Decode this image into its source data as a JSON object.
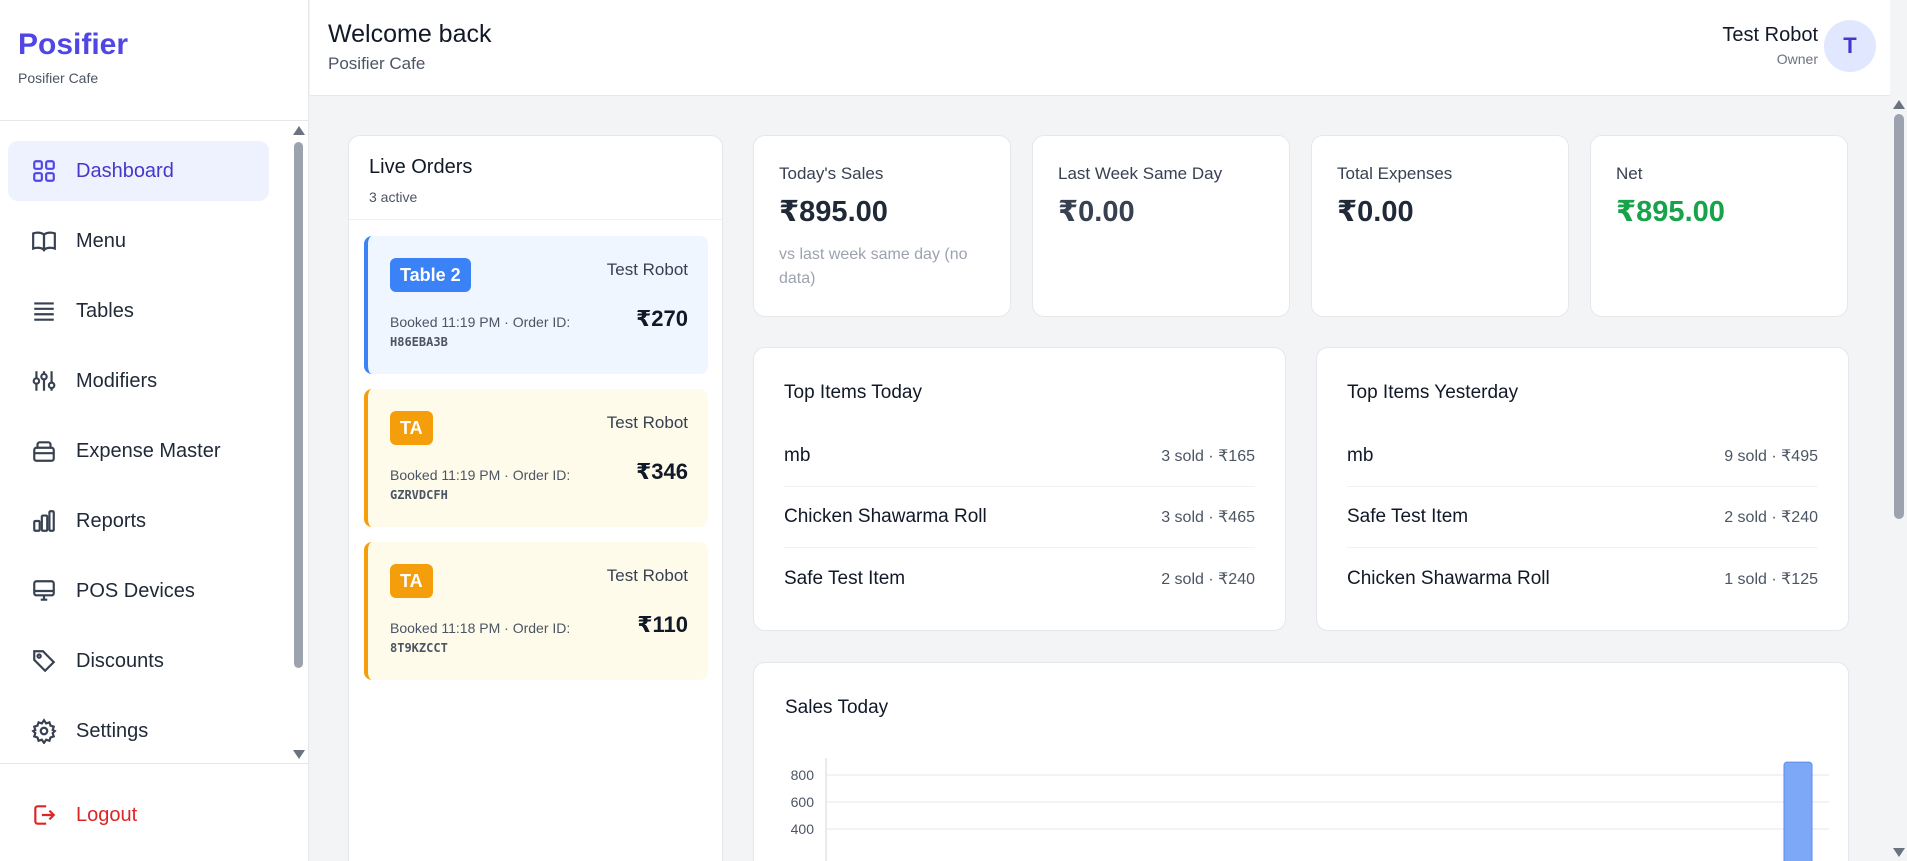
{
  "sidebar": {
    "brand": "Posifier",
    "subtitle": "Posifier Cafe",
    "items": [
      {
        "label": "Dashboard",
        "icon": "grid-icon",
        "active": true
      },
      {
        "label": "Menu",
        "icon": "book-icon"
      },
      {
        "label": "Tables",
        "icon": "list-icon"
      },
      {
        "label": "Modifiers",
        "icon": "sliders-icon"
      },
      {
        "label": "Expense Master",
        "icon": "wallet-icon"
      },
      {
        "label": "Reports",
        "icon": "bar-chart-icon"
      },
      {
        "label": "POS Devices",
        "icon": "monitor-icon"
      },
      {
        "label": "Discounts",
        "icon": "tag-icon"
      },
      {
        "label": "Settings",
        "icon": "gear-icon"
      }
    ],
    "logout": "Logout"
  },
  "header": {
    "title": "Welcome back",
    "subtitle": "Posifier Cafe",
    "user_name": "Test Robot",
    "user_role": "Owner",
    "avatar_initial": "T"
  },
  "live_orders": {
    "title": "Live Orders",
    "count": "3 active",
    "orders": [
      {
        "tag": "Table 2",
        "waiter": "Test Robot",
        "booked": "Booked 11:19 PM · Order ID:",
        "order_id": "H86EBA3B",
        "amount": "₹270",
        "kind": "table"
      },
      {
        "tag": "TA",
        "waiter": "Test Robot",
        "booked": "Booked 11:19 PM · Order ID:",
        "order_id": "GZRVDCFH",
        "amount": "₹346",
        "kind": "takeaway"
      },
      {
        "tag": "TA",
        "waiter": "Test Robot",
        "booked": "Booked 11:18 PM · Order ID:",
        "order_id": "8T9KZCCT",
        "amount": "₹110",
        "kind": "takeaway"
      }
    ]
  },
  "stats": [
    {
      "label": "Today's Sales",
      "value": "₹895.00",
      "note": "vs last week same day (no data)"
    },
    {
      "label": "Last Week Same Day",
      "value": "₹0.00"
    },
    {
      "label": "Total Expenses",
      "value": "₹0.00"
    },
    {
      "label": "Net",
      "value": "₹895.00"
    }
  ],
  "top_today": {
    "title": "Top Items Today",
    "items": [
      {
        "name": "mb",
        "meta": "3 sold · ₹165"
      },
      {
        "name": "Chicken Shawarma Roll",
        "meta": "3 sold · ₹465"
      },
      {
        "name": "Safe Test Item",
        "meta": "2 sold · ₹240"
      }
    ]
  },
  "top_yesterday": {
    "title": "Top Items Yesterday",
    "items": [
      {
        "name": "mb",
        "meta": "9 sold · ₹495"
      },
      {
        "name": "Safe Test Item",
        "meta": "2 sold · ₹240"
      },
      {
        "name": "Chicken Shawarma Roll",
        "meta": "1 sold · ₹125"
      }
    ]
  },
  "sales_today": {
    "title": "Sales Today"
  },
  "chart_data": {
    "type": "bar",
    "title": "Sales Today",
    "y_ticks": [
      800,
      600,
      400
    ],
    "ylim": [
      0,
      900
    ],
    "values": [
      895
    ],
    "grid": true
  },
  "colors": {
    "accent": "#4f46e5",
    "table_tag": "#3b82f6",
    "takeaway_tag": "#f59e0b",
    "net_green": "#16a34a",
    "logout_red": "#dc2626",
    "bar": "#7da7f7"
  }
}
